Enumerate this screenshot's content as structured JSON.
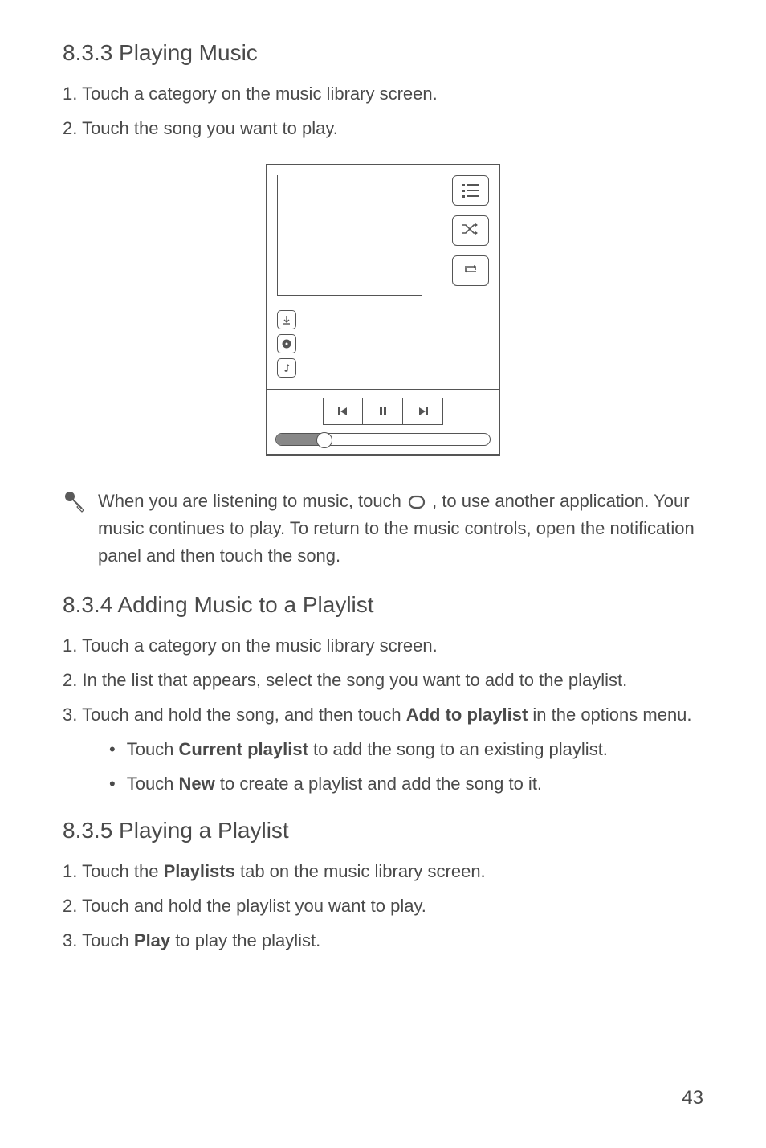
{
  "sections": {
    "s833": {
      "heading": "8.3.3  Playing Music",
      "steps": [
        "1. Touch a category on the music library screen.",
        "2. Touch the song you want to play."
      ]
    },
    "tip": {
      "before": "When you are listening to music, touch ",
      "after": " , to use another application. Your music continues to play. To return to the music controls, open the notification panel and then touch the song."
    },
    "s834": {
      "heading": "8.3.4  Adding Music to a Playlist",
      "step1": "1. Touch a category on the music library screen.",
      "step2": "2. In the list that appears, select the song you want to add to the playlist.",
      "step3_before": "3. Touch and hold the song, and then touch ",
      "step3_bold": "Add to playlist",
      "step3_after": " in the options menu.",
      "bullet1_before": "Touch ",
      "bullet1_bold": "Current playlist",
      "bullet1_after": " to add the song to an existing playlist.",
      "bullet2_before": "Touch ",
      "bullet2_bold": "New",
      "bullet2_after": " to create a playlist and add the song to it."
    },
    "s835": {
      "heading": "8.3.5  Playing a Playlist",
      "step1_before": "1. Touch the ",
      "step1_bold": "Playlists",
      "step1_after": " tab on the music library screen.",
      "step2": "2. Touch and hold the playlist you want to play.",
      "step3_before": "3. Touch ",
      "step3_bold": "Play",
      "step3_after": " to play the playlist."
    }
  },
  "page_number": "43"
}
